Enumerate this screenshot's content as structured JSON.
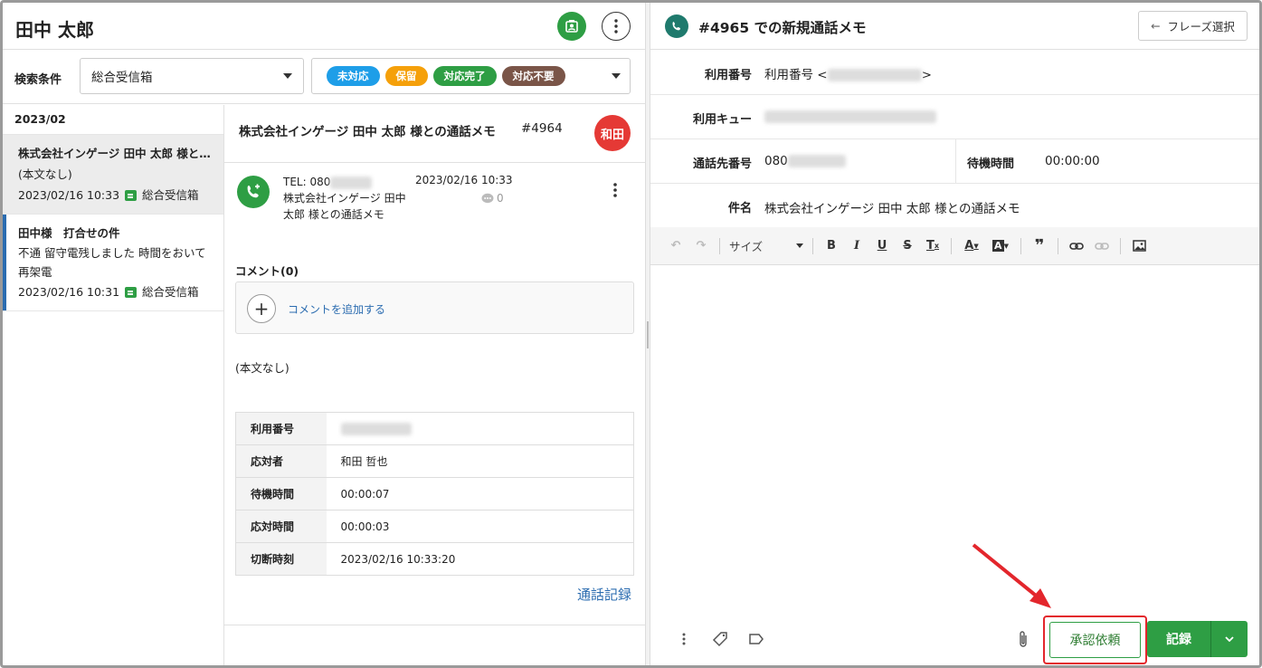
{
  "left": {
    "title": "田中 太郎",
    "search_label": "検索条件",
    "search_value": "総合受信箱",
    "status_tags": [
      {
        "label": "未対応",
        "color": "#1e9ee8"
      },
      {
        "label": "保留",
        "color": "#f5a00a"
      },
      {
        "label": "対応完了",
        "color": "#2e9e44"
      },
      {
        "label": "対応不要",
        "color": "#7a5548"
      }
    ]
  },
  "list": {
    "month": "2023/02",
    "items": [
      {
        "title": "株式会社インゲージ 田中 太郎 様と…",
        "body": "(本文なし)",
        "date": "2023/02/16 10:33",
        "box": "総合受信箱"
      },
      {
        "title": "田中様　打合せの件",
        "body": "不通 留守電残しました 時間をおいて再架電",
        "date": "2023/02/16 10:31",
        "box": "総合受信箱"
      }
    ]
  },
  "detail": {
    "title": "株式会社インゲージ 田中 太郎 様との通話メモ",
    "number": "#4964",
    "avatar": "和田",
    "tel": "TEL: 080",
    "caller": "株式会社インゲージ 田中 太郎 様との通話メモ",
    "datetime": "2023/02/16 10:33",
    "comment_count": "0",
    "comment_label": "コメント(0)",
    "add_comment": "コメントを追加する",
    "body": "(本文なし)",
    "table": [
      {
        "k": "利用番号",
        "v": ""
      },
      {
        "k": "応対者",
        "v": "和田 哲也"
      },
      {
        "k": "待機時間",
        "v": "00:00:07"
      },
      {
        "k": "応対時間",
        "v": "00:00:03"
      },
      {
        "k": "切断時刻",
        "v": "2023/02/16 10:33:20"
      }
    ],
    "call_log_link": "通話記録"
  },
  "right": {
    "title": "#4965 での新規通話メモ",
    "phrase_button": "フレーズ選択",
    "use_number_label": "利用番号",
    "use_number_value_prefix": "利用番号 <",
    "use_number_value_suffix": ">",
    "queue_label": "利用キュー",
    "dest_label": "通話先番号",
    "dest_value": "080",
    "wait_label": "待機時間",
    "wait_value": "00:00:00",
    "subject_label": "件名",
    "subject_value": "株式会社インゲージ 田中 太郎 様との通話メモ",
    "size_label": "サイズ",
    "approve_button": "承認依頼",
    "record_button": "記録"
  }
}
